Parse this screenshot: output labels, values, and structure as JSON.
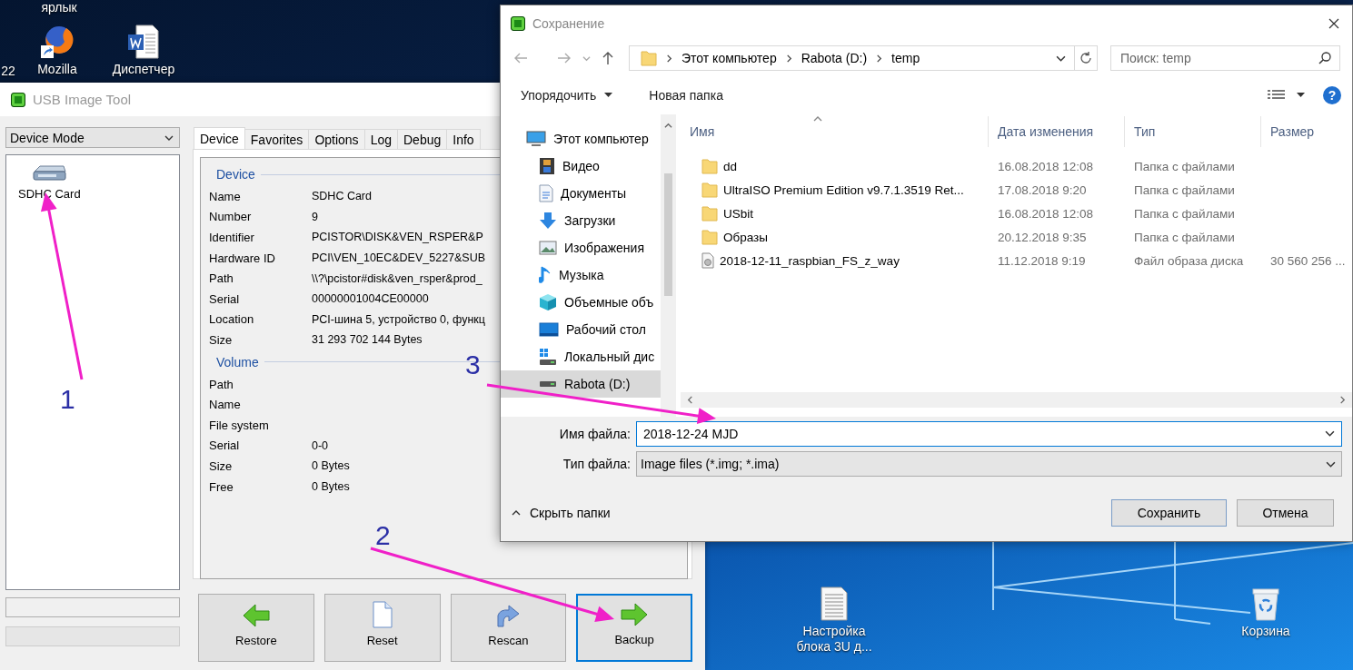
{
  "desktop": {
    "icons": [
      {
        "label": "ярлык",
        "kind": "label"
      },
      {
        "label": "22",
        "kind": "label"
      },
      {
        "label": "Mozilla",
        "kind": "browser"
      },
      {
        "label": "Диспетчер",
        "kind": "word-document"
      },
      {
        "label": "Настройка блока 3U д...",
        "kind": "text-document"
      },
      {
        "label": "Корзина",
        "kind": "recycle-bin"
      }
    ]
  },
  "usb_tool": {
    "title": "USB Image Tool",
    "mode": "Device Mode",
    "devices": [
      {
        "label": "SDHC Card",
        "selected": false
      }
    ],
    "tabs": [
      {
        "label": "Device",
        "selected": true
      },
      {
        "label": "Favorites",
        "selected": false
      },
      {
        "label": "Options",
        "selected": false
      },
      {
        "label": "Log",
        "selected": false
      },
      {
        "label": "Debug",
        "selected": false
      },
      {
        "label": "Info",
        "selected": false
      }
    ],
    "groups": [
      {
        "title": "Device",
        "rows": [
          {
            "label": "Name",
            "value": "SDHC Card"
          },
          {
            "label": "Number",
            "value": "9"
          },
          {
            "label": "Identifier",
            "value": "PCISTOR\\DISK&VEN_RSPER&P"
          },
          {
            "label": "Hardware ID",
            "value": "PCI\\VEN_10EC&DEV_5227&SUB"
          },
          {
            "label": "Path",
            "value": "\\\\?\\pcistor#disk&ven_rsper&prod_"
          },
          {
            "label": "Serial",
            "value": "00000001004CE00000"
          },
          {
            "label": "Location",
            "value": "PCI-шина 5, устройство 0, функц"
          },
          {
            "label": "Size",
            "value": "31 293 702 144 Bytes"
          }
        ]
      },
      {
        "title": "Volume",
        "rows": [
          {
            "label": "Path"
          },
          {
            "label": "Name"
          },
          {
            "label": "File system"
          },
          {
            "label": "Serial",
            "value": "0-0"
          },
          {
            "label": "Size",
            "value": "0 Bytes"
          },
          {
            "label": "Free",
            "value": "0 Bytes"
          }
        ]
      }
    ],
    "buttons": [
      {
        "label": "Restore",
        "kind": "restore",
        "focused": false
      },
      {
        "label": "Reset",
        "kind": "reset",
        "focused": false
      },
      {
        "label": "Rescan",
        "kind": "rescan",
        "focused": false
      },
      {
        "label": "Backup",
        "kind": "backup",
        "focused": true
      }
    ]
  },
  "save_dialog": {
    "title": "Сохранение",
    "breadcrumbs": [
      "Этот компьютер",
      "Rabota (D:)",
      "temp"
    ],
    "search": {
      "placeholder": "Поиск: temp"
    },
    "toolbar": {
      "organize": "Упорядочить",
      "new_folder": "Новая папка",
      "help": "?"
    },
    "nav": [
      {
        "label": "Этот компьютер",
        "kind": "computer",
        "selected": false,
        "children": [
          {
            "label": "Видео",
            "kind": "video",
            "selected": false
          },
          {
            "label": "Документы",
            "kind": "documents",
            "selected": false
          },
          {
            "label": "Загрузки",
            "kind": "downloads",
            "selected": false
          },
          {
            "label": "Изображения",
            "kind": "pictures",
            "selected": false
          },
          {
            "label": "Музыка",
            "kind": "music",
            "selected": false
          },
          {
            "label": "Объемные объ",
            "kind": "objects",
            "selected": false
          },
          {
            "label": "Рабочий стол",
            "kind": "desktop",
            "selected": false
          },
          {
            "label": "Локальный дис",
            "kind": "system-drive",
            "selected": false
          },
          {
            "label": "Rabota (D:)",
            "kind": "drive",
            "selected": true
          }
        ]
      }
    ],
    "columns": [
      "Имя",
      "Дата изменения",
      "Тип",
      "Размер"
    ],
    "files": [
      {
        "name": "dd",
        "date": "16.08.2018 12:08",
        "type": "Папка с файлами",
        "kind": "folder"
      },
      {
        "name": "UltraISO Premium Edition v9.7.1.3519 Ret...",
        "date": "17.08.2018 9:20",
        "type": "Папка с файлами",
        "kind": "folder"
      },
      {
        "name": "USbit",
        "date": "16.08.2018 12:08",
        "type": "Папка с файлами",
        "kind": "folder"
      },
      {
        "name": "Образы",
        "date": "20.12.2018 9:35",
        "type": "Папка с файлами",
        "kind": "folder"
      },
      {
        "name": "2018-12-11_raspbian_FS_z_way",
        "date": "11.12.2018 9:19",
        "type": "Файл образа диска",
        "size": "30 560 256 ...",
        "kind": "disk-image"
      }
    ],
    "file_name": {
      "label": "Имя файла:",
      "value": "2018-12-24 MJD"
    },
    "file_type": {
      "label": "Тип файла:",
      "value": "Image files (*.img; *.ima)"
    },
    "hide_folders": "Скрыть папки",
    "buttons": [
      {
        "label": "Сохранить",
        "default": true
      },
      {
        "label": "Отмена",
        "default": false
      }
    ]
  },
  "annotations": [
    {
      "number": "1"
    },
    {
      "number": "2"
    },
    {
      "number": "3"
    }
  ]
}
